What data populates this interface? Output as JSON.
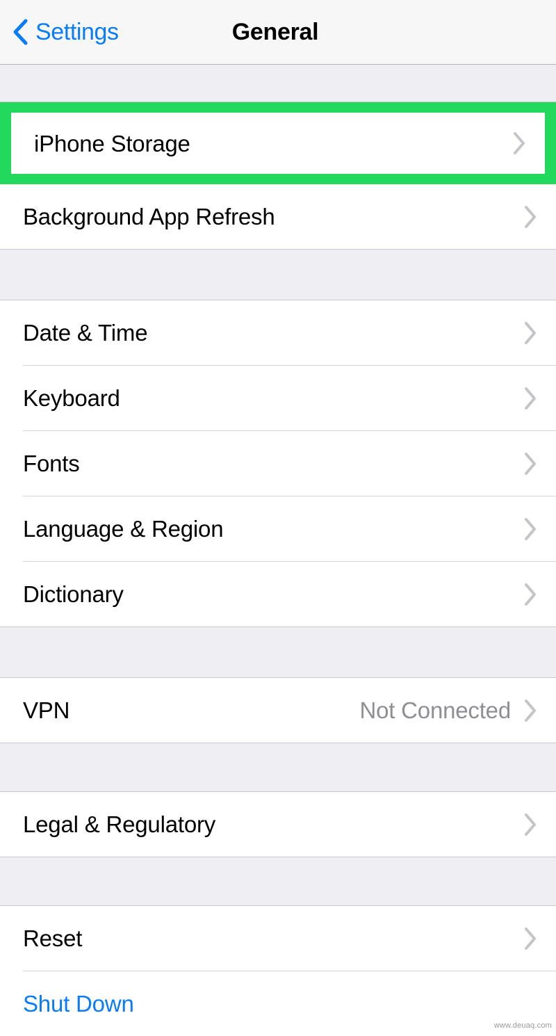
{
  "navbar": {
    "back_label": "Settings",
    "back_icon": "chevron-left-icon",
    "title": "General"
  },
  "colors": {
    "accent_blue": "#0a7cf7",
    "highlight_green": "#22d95c",
    "value_gray": "#8e8e93",
    "group_gap_gray": "#eeeef3",
    "chevron_gray": "#c4c4c9"
  },
  "sections": [
    {
      "name": "storage-section",
      "rows": [
        {
          "label": "iPhone Storage",
          "value": "",
          "accessory": "chevron-right-icon",
          "highlighted": true,
          "style": "default"
        },
        {
          "label": "Background App Refresh",
          "value": "",
          "accessory": "chevron-right-icon",
          "highlighted": false,
          "style": "default"
        }
      ]
    },
    {
      "name": "localization-section",
      "rows": [
        {
          "label": "Date & Time",
          "value": "",
          "accessory": "chevron-right-icon",
          "highlighted": false,
          "style": "default"
        },
        {
          "label": "Keyboard",
          "value": "",
          "accessory": "chevron-right-icon",
          "highlighted": false,
          "style": "default"
        },
        {
          "label": "Fonts",
          "value": "",
          "accessory": "chevron-right-icon",
          "highlighted": false,
          "style": "default"
        },
        {
          "label": "Language & Region",
          "value": "",
          "accessory": "chevron-right-icon",
          "highlighted": false,
          "style": "default"
        },
        {
          "label": "Dictionary",
          "value": "",
          "accessory": "chevron-right-icon",
          "highlighted": false,
          "style": "default"
        }
      ]
    },
    {
      "name": "vpn-section",
      "rows": [
        {
          "label": "VPN",
          "value": "Not Connected",
          "accessory": "chevron-right-icon",
          "highlighted": false,
          "style": "default"
        }
      ]
    },
    {
      "name": "legal-section",
      "rows": [
        {
          "label": "Legal & Regulatory",
          "value": "",
          "accessory": "chevron-right-icon",
          "highlighted": false,
          "style": "default"
        }
      ]
    },
    {
      "name": "reset-section",
      "rows": [
        {
          "label": "Reset",
          "value": "",
          "accessory": "chevron-right-icon",
          "highlighted": false,
          "style": "default"
        },
        {
          "label": "Shut Down",
          "value": "",
          "accessory": "none",
          "highlighted": false,
          "style": "blue"
        }
      ]
    }
  ],
  "watermark": {
    "text": "www.deuaq.com"
  }
}
